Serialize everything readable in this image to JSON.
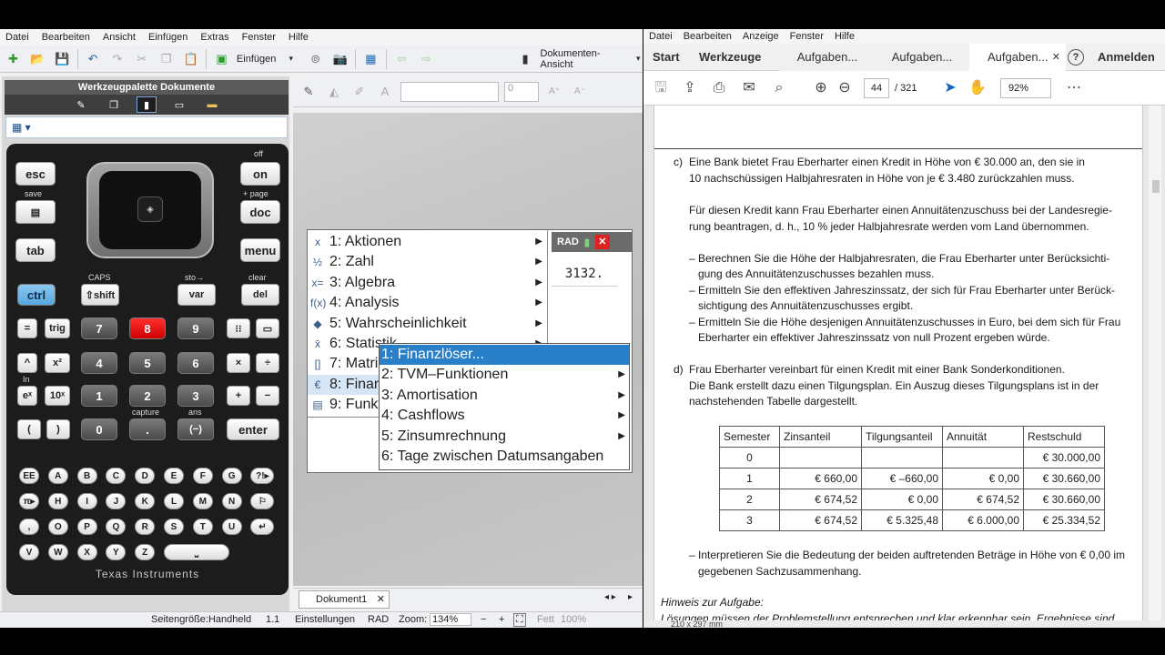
{
  "ti_app": {
    "menu": [
      "Datei",
      "Bearbeiten",
      "Ansicht",
      "Einfügen",
      "Extras",
      "Fenster",
      "Hilfe"
    ],
    "toolbar": {
      "insert_label": "Einfügen",
      "view_label": "Dokumenten-Ansicht"
    },
    "palette": {
      "title": "Werkzeugpalette Dokumente",
      "tabs": [
        "tools-icon",
        "pages-icon",
        "handheld-icon",
        "book-icon",
        "folder-icon"
      ]
    },
    "handheld": {
      "labels": {
        "off": "off",
        "save": "save",
        "page": "+ page",
        "caps": "CAPS",
        "sto": "sto→",
        "clear": "clear",
        "capture": "capture",
        "ans": "ans",
        "in": "In",
        "brand": "Texas Instruments"
      },
      "keys": {
        "esc": "esc",
        "home": "on",
        "doc": "doc",
        "menu": "menu",
        "tab": "tab",
        "ctrl": "ctrl",
        "shift": "⇧shift",
        "var": "var",
        "del": "del",
        "eq": "=",
        "trig": "trig",
        "k7": "7",
        "k8": "8",
        "k9": "9",
        "caret": "^",
        "sq": "x²",
        "k4": "4",
        "k5": "5",
        "k6": "6",
        "mul": "×",
        "div": "÷",
        "exp": "eˣ",
        "tenx": "10ˣ",
        "k1": "1",
        "k2": "2",
        "k3": "3",
        "plus": "+",
        "minus": "−",
        "lparen": "(",
        "rparen": ")",
        "k0": "0",
        "dot": ".",
        "neg": "(−)",
        "enter": "enter"
      },
      "alpha": [
        [
          "EE",
          "A",
          "B",
          "C",
          "D",
          "E",
          "F",
          "G",
          "?!▸"
        ],
        [
          "π▸",
          "H",
          "I",
          "J",
          "K",
          "L",
          "M",
          "N",
          "⚐"
        ],
        [
          ",",
          "O",
          "P",
          "Q",
          "R",
          "S",
          "T",
          "U",
          "↵"
        ],
        [
          "V",
          "W",
          "X",
          "Y",
          "Z",
          "⎵"
        ]
      ]
    },
    "screen": {
      "mode": "RAD",
      "result": "3132.",
      "menu1": [
        {
          "num": "1:",
          "label": "Aktionen",
          "icon": "x"
        },
        {
          "num": "2:",
          "label": "Zahl",
          "icon": "½"
        },
        {
          "num": "3:",
          "label": "Algebra",
          "icon": "x="
        },
        {
          "num": "4:",
          "label": "Analysis",
          "icon": "f(x)"
        },
        {
          "num": "5:",
          "label": "Wahrscheinlichkeit",
          "icon": "◆"
        },
        {
          "num": "6:",
          "label": "Statistik",
          "icon": "x̄"
        },
        {
          "num": "7:",
          "label": "Matrix & Vektor",
          "icon": "[]"
        },
        {
          "num": "8:",
          "label": "Finanzen",
          "icon": "€"
        },
        {
          "num": "9:",
          "label": "Funktionen & Programme",
          "icon": "▤"
        }
      ],
      "menu2": [
        {
          "label": "1: Finanzlöser...",
          "arrow": false
        },
        {
          "label": "2: TVM–Funktionen",
          "arrow": true
        },
        {
          "label": "3: Amortisation",
          "arrow": true
        },
        {
          "label": "4: Cashflows",
          "arrow": true
        },
        {
          "label": "5: Zinsumrechnung",
          "arrow": true
        },
        {
          "label": "6: Tage zwischen Datumsangaben",
          "arrow": false
        }
      ]
    },
    "doc_tab": "Dokument1",
    "docbar": {
      "size_value": "0"
    },
    "status": {
      "page_size": "Seitengröße:Handheld",
      "page": "1.1",
      "settings": "Einstellungen",
      "mode": "RAD",
      "zoom_label": "Zoom:",
      "zoom": "134%",
      "fett_label": "Fett",
      "fett": "100%"
    }
  },
  "pdf_app": {
    "menu": [
      "Datei",
      "Bearbeiten",
      "Anzeige",
      "Fenster",
      "Hilfe"
    ],
    "tabs": {
      "start": "Start",
      "tools": "Werkzeuge",
      "doc1": "Aufgaben...",
      "doc2": "Aufgaben...",
      "doc3": "Aufgaben...",
      "signin": "Anmelden"
    },
    "page_current": "44",
    "page_total": "/ 321",
    "zoom": "92%",
    "content": {
      "c_label": "c)",
      "c_line1": "Eine Bank bietet Frau Eberharter einen Kredit in Höhe von € 30.000 an, den sie in",
      "c_line2": "10 nachschüssigen Halbjahresraten in Höhe von je € 3.480 zurückzahlen muss.",
      "c_p2_line1": "Für diesen Kredit kann Frau Eberharter einen Annuitätenzuschuss bei der Landesregie-",
      "c_p2_line2": "rung beantragen, d. h., 10 % jeder Halbjahresrate werden vom Land übernommen.",
      "c_b1_line1": "– Berechnen Sie die Höhe der Halbjahresraten, die Frau Eberharter unter Berücksichti-",
      "c_b1_line2": "gung des Annuitätenzuschusses bezahlen muss.",
      "c_b2_line1": "– Ermitteln Sie den effektiven Jahreszinssatz, der sich für Frau Eberharter unter Berück-",
      "c_b2_line2": "sichtigung des Annuitätenzuschusses ergibt.",
      "c_b3_line1": "– Ermitteln Sie die Höhe desjenigen Annuitätenzuschusses in Euro, bei dem sich für Frau",
      "c_b3_line2": "Eberharter ein effektiver Jahreszinssatz von null Prozent ergeben würde.",
      "d_label": "d)",
      "d_line1": "Frau Eberharter vereinbart für einen Kredit mit einer Bank Sonderkonditionen.",
      "d_line2": "Die Bank erstellt dazu einen Tilgungsplan. Ein Auszug dieses Tilgungsplans ist in der",
      "d_line3": "nachstehenden Tabelle dargestellt.",
      "table_headers": [
        "Semester",
        "Zinsanteil",
        "Tilgungsanteil",
        "Annuität",
        "Restschuld"
      ],
      "table_rows": [
        [
          "0",
          "",
          "",
          "",
          "€ 30.000,00"
        ],
        [
          "1",
          "€ 660,00",
          "€ –660,00",
          "€ 0,00",
          "€ 30.660,00"
        ],
        [
          "2",
          "€ 674,52",
          "€ 0,00",
          "€ 674,52",
          "€ 30.660,00"
        ],
        [
          "3",
          "€ 674,52",
          "€ 5.325,48",
          "€ 6.000,00",
          "€ 25.334,52"
        ]
      ],
      "d_b1_line1": "– Interpretieren Sie die Bedeutung der beiden auftretenden Beträge in Höhe von € 0,00 im",
      "d_b1_line2": "gegebenen Sachzusammenhang.",
      "hint": "Hinweis zur Aufgabe:",
      "hint_cut": "Lösungen müssen der Problemstellung entsprechen und klar erkennbar sein. Ergebnisse sind",
      "page_size": "210 x 297 mm"
    }
  }
}
